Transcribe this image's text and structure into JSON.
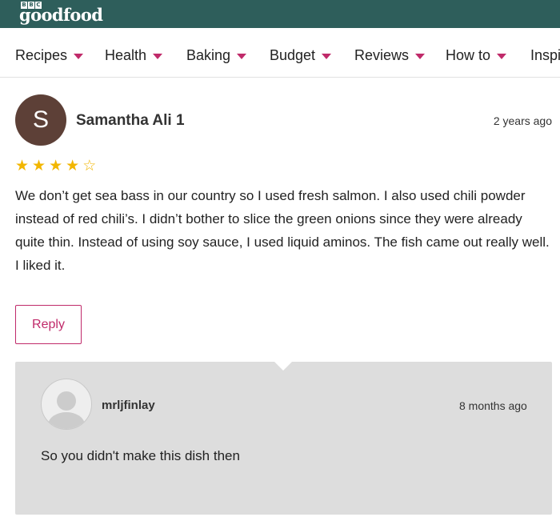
{
  "brand": {
    "bbc": [
      "B",
      "B",
      "C"
    ],
    "name": "goodfood",
    "header_color": "#2e5e5b"
  },
  "nav": {
    "items": [
      {
        "label": "Recipes"
      },
      {
        "label": "Health"
      },
      {
        "label": "Baking"
      },
      {
        "label": "Budget"
      },
      {
        "label": "Reviews"
      },
      {
        "label": "How to"
      },
      {
        "label": "Inspi"
      }
    ],
    "caret_color": "#c02a6a"
  },
  "review": {
    "avatar_letter": "S",
    "author": "Samantha Ali 1",
    "time": "2 years ago",
    "rating": 4,
    "rating_max": 5,
    "text": "We don’t get sea bass in our country so I used fresh salmon. I also used chili powder instead of red chili’s. I didn’t bother to slice the green onions since they were already quite thin. Instead of using soy sauce, I used liquid aminos. The fish came out really well. I liked it.",
    "reply_label": "Reply"
  },
  "reply": {
    "author": "mrljfinlay",
    "time": "8 months ago",
    "text": "So you didn't make this dish then"
  }
}
